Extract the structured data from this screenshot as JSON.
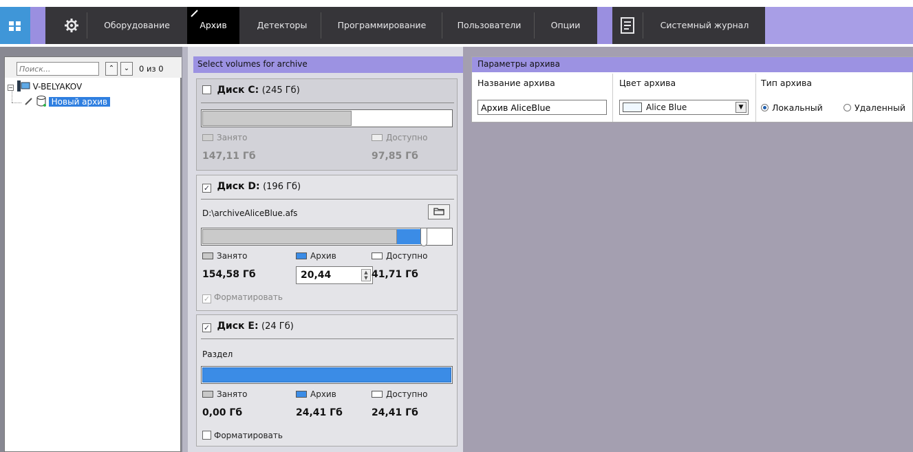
{
  "topbar": {
    "tabs": [
      {
        "label": "Оборудование"
      },
      {
        "label": "Архив"
      },
      {
        "label": "Детекторы"
      },
      {
        "label": "Программирование"
      },
      {
        "label": "Пользователи"
      },
      {
        "label": "Опции"
      },
      {
        "label": "Системный журнал"
      }
    ],
    "active_tab": "Архив",
    "icons": [
      "grid-menu-icon",
      "gear-icon",
      "pencil-icon",
      "journal-icon"
    ]
  },
  "tree": {
    "search_placeholder": "Поиск...",
    "count": "0 из 0",
    "server": "V-BELYAKOV",
    "archive_node": "Новый архив"
  },
  "volumes": {
    "header": "Select volumes for archive",
    "disk_c": {
      "name": "Диск C:",
      "size": "(245 Гб)",
      "checked": false,
      "used_label": "Занято",
      "free_label": "Доступно",
      "used_value": "147,11 Гб",
      "free_value": "97,85 Гб",
      "used_fraction": 0.6
    },
    "disk_d": {
      "name": "Диск D:",
      "size": "(196 Гб)",
      "checked": true,
      "path": "D:\\archiveAliceBlue.afs",
      "used_label": "Занято",
      "archive_label": "Архив",
      "free_label": "Доступно",
      "used_value": "154,58 Гб",
      "archive_value": "20,44",
      "free_value": "41,71 Гб",
      "format_label": "Форматировать",
      "format_checked": true
    },
    "disk_e": {
      "name": "Диск E:",
      "size": "(24 Гб)",
      "checked": true,
      "partition_label": "Раздел",
      "used_label": "Занято",
      "archive_label": "Архив",
      "free_label": "Доступно",
      "used_value": "0,00 Гб",
      "archive_value": "24,41 Гб",
      "free_value": "24,41 Гб",
      "format_label": "Форматировать",
      "format_checked": false
    }
  },
  "params": {
    "header": "Параметры архива",
    "name_label": "Название архива",
    "name_value": "Архив AliceBlue",
    "color_label": "Цвет архива",
    "color_value": "Alice Blue",
    "color_hex": "#f0f8ff",
    "type_label": "Тип архива",
    "type_local": "Локальный",
    "type_remote": "Удаленный",
    "type_selected": "Локальный"
  },
  "colors": {
    "accent_purple": "#9c92e2",
    "selection_blue": "#2f7fe0",
    "archive_bar_blue": "#3b8ce6",
    "topbar_dark": "#363539"
  }
}
